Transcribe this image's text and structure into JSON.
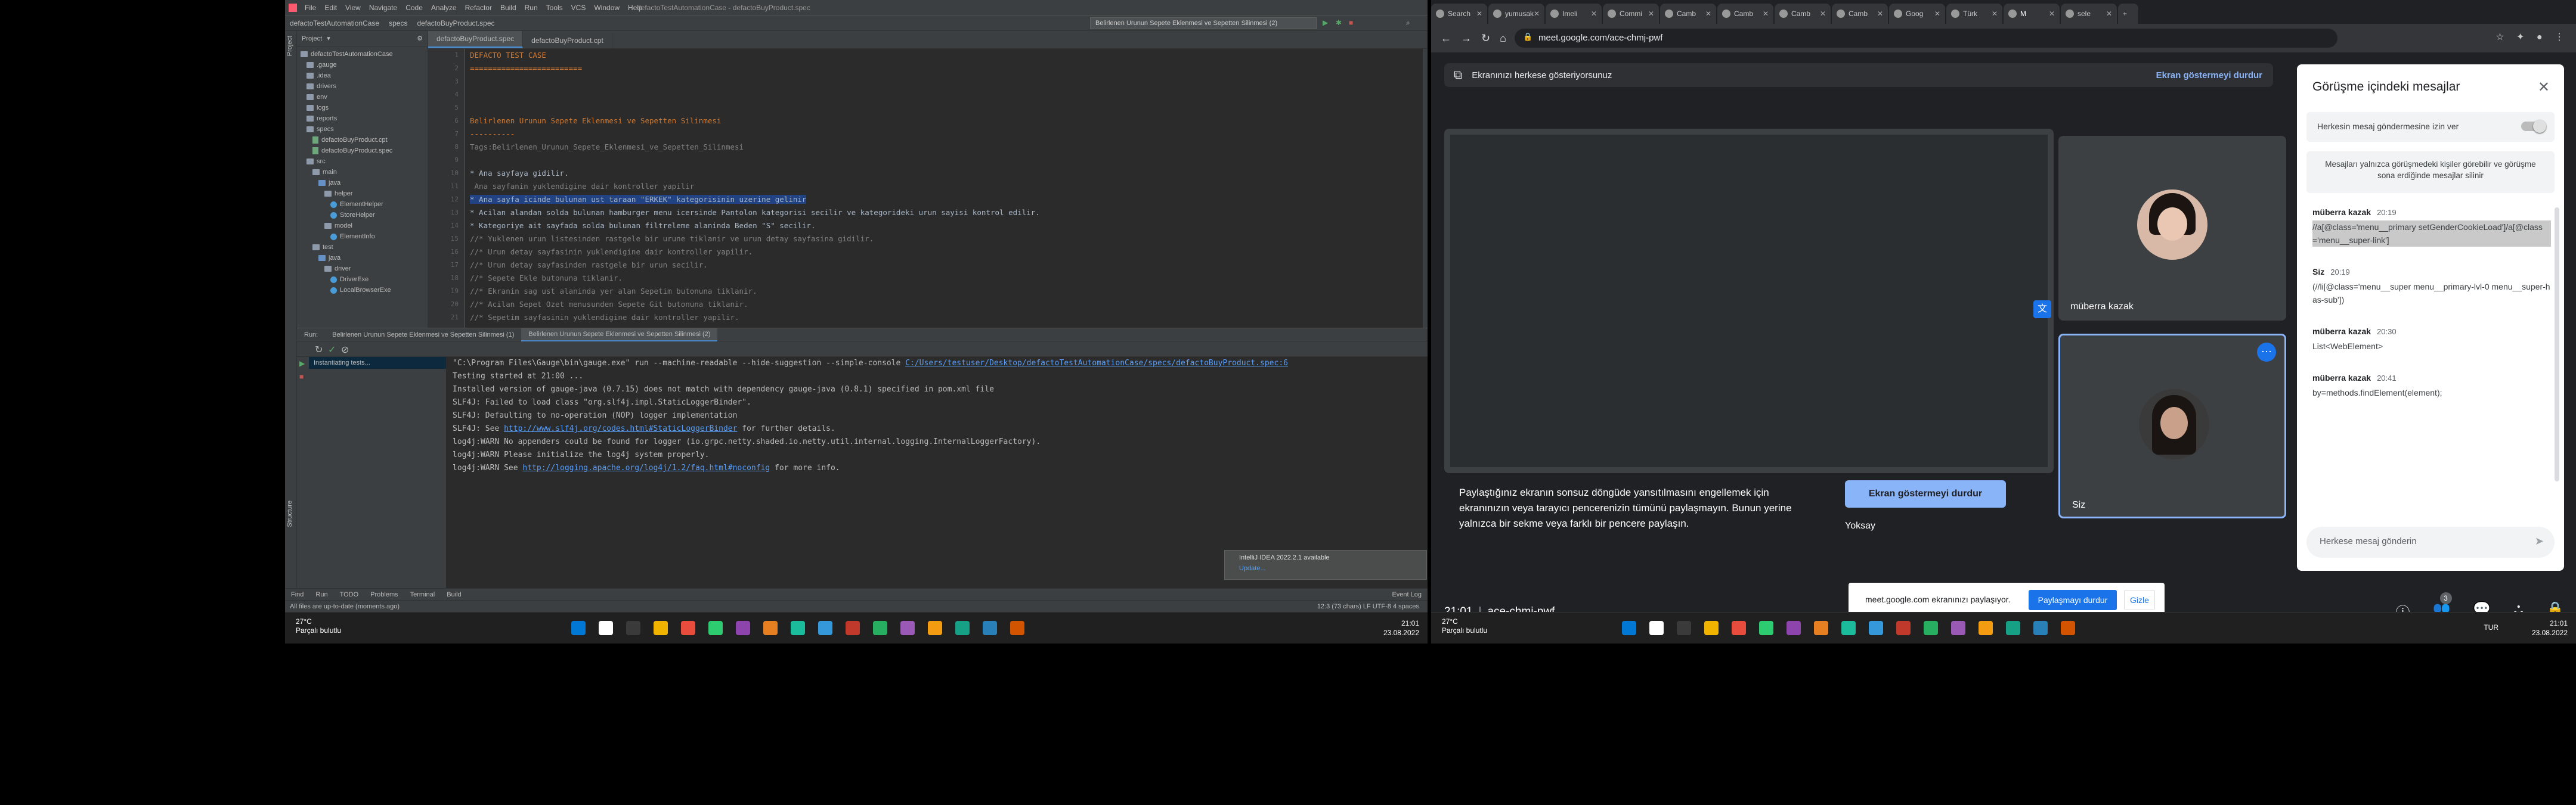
{
  "ide": {
    "menu": [
      "File",
      "Edit",
      "View",
      "Navigate",
      "Code",
      "Analyze",
      "Refactor",
      "Build",
      "Run",
      "Tools",
      "VCS",
      "Window",
      "Help"
    ],
    "window_title": "defactoTestAutomationCase - defactoBuyProduct.spec",
    "breadcrumbs": [
      "defactoTestAutomationCase",
      "specs",
      "defactoBuyProduct.spec"
    ],
    "run_config": "Belirlenen Urunun Sepete Eklenmesi ve Sepetten Silinmesi (2)",
    "project_label": "Project",
    "project_tree": [
      {
        "label": "defactoTestAutomationCase",
        "type": "folder",
        "depth": 0
      },
      {
        "label": ".gauge",
        "type": "folder",
        "depth": 1
      },
      {
        "label": ".idea",
        "type": "folder",
        "depth": 1
      },
      {
        "label": "drivers",
        "type": "folder",
        "depth": 1
      },
      {
        "label": "env",
        "type": "folder",
        "depth": 1
      },
      {
        "label": "logs",
        "type": "folder",
        "depth": 1
      },
      {
        "label": "reports",
        "type": "folder",
        "depth": 1
      },
      {
        "label": "specs",
        "type": "folder",
        "depth": 1
      },
      {
        "label": "defactoBuyProduct.cpt",
        "type": "file",
        "depth": 2
      },
      {
        "label": "defactoBuyProduct.spec",
        "type": "file",
        "depth": 2
      },
      {
        "label": "src",
        "type": "folder",
        "depth": 1
      },
      {
        "label": "main",
        "type": "folder",
        "depth": 2
      },
      {
        "label": "java",
        "type": "folder-blue",
        "depth": 3
      },
      {
        "label": "helper",
        "type": "folder",
        "depth": 4
      },
      {
        "label": "ElementHelper",
        "type": "java",
        "depth": 5
      },
      {
        "label": "StoreHelper",
        "type": "java",
        "depth": 5
      },
      {
        "label": "model",
        "type": "folder",
        "depth": 4
      },
      {
        "label": "ElementInfo",
        "type": "java",
        "depth": 5
      },
      {
        "label": "test",
        "type": "folder",
        "depth": 2
      },
      {
        "label": "java",
        "type": "folder-blue",
        "depth": 3
      },
      {
        "label": "driver",
        "type": "folder",
        "depth": 4
      },
      {
        "label": "DriverExe",
        "type": "java",
        "depth": 5
      },
      {
        "label": "LocalBrowserExe",
        "type": "java",
        "depth": 5
      }
    ],
    "editor_tabs": [
      "defactoBuyProduct.spec",
      "defactoBuyProduct.cpt"
    ],
    "code_lines": [
      {
        "n": "1",
        "t": "DEFACTO TEST CASE",
        "c": "c-orange"
      },
      {
        "n": "2",
        "t": "=========================",
        "c": "c-orange"
      },
      {
        "n": "3",
        "t": "",
        "c": "c-white"
      },
      {
        "n": "4",
        "t": "",
        "c": "c-white"
      },
      {
        "n": "5",
        "t": "",
        "c": "c-white"
      },
      {
        "n": "6",
        "t": "Belirlenen Urunun Sepete Eklenmesi ve Sepetten Silinmesi",
        "c": "c-orange"
      },
      {
        "n": "7",
        "t": "----------",
        "c": "c-orange"
      },
      {
        "n": "8",
        "t": "Tags:Belirlenen_Urunun_Sepete_Eklenmesi_ve_Sepetten_Silinmesi",
        "c": "c-gray"
      },
      {
        "n": "9",
        "t": "",
        "c": "c-white"
      },
      {
        "n": "10",
        "t": "* Ana sayfaya gidilir.",
        "c": "c-white"
      },
      {
        "n": "11",
        "t": " Ana sayfanin yuklendigine dair kontroller yapilir",
        "c": "c-gray"
      },
      {
        "n": "12",
        "t": "* Ana sayfa icinde bulunan ust taraan \"ERKEK\" kategorisinin uzerine gelinir",
        "c": "c-white",
        "hl": true
      },
      {
        "n": "13",
        "t": "* Acilan alandan solda bulunan hamburger menu icersinde Pantolon kategorisi secilir ve kategorideki urun sayisi kontrol edilir.",
        "c": "c-white"
      },
      {
        "n": "14",
        "t": "* Kategoriye ait sayfada solda bulunan filtreleme alaninda Beden \"S\" secilir.",
        "c": "c-white"
      },
      {
        "n": "15",
        "t": "//* Yuklenen urun listesinden rastgele bir urune tiklanir ve urun detay sayfasina gidilir.",
        "c": "c-gray"
      },
      {
        "n": "16",
        "t": "//* Urun detay sayfasinin yuklendigine dair kontroller yapilir.",
        "c": "c-gray"
      },
      {
        "n": "17",
        "t": "//* Urun detay sayfasinden rastgele bir urun secilir.",
        "c": "c-gray"
      },
      {
        "n": "18",
        "t": "//* Sepete Ekle butonuna tiklanir.",
        "c": "c-gray"
      },
      {
        "n": "19",
        "t": "//* Ekranin sag ust alaninda yer alan Sepetim butonuna tiklanir.",
        "c": "c-gray"
      },
      {
        "n": "20",
        "t": "//* Acilan Sepet Ozet menusunden Sepete Git butonuna tiklanir.",
        "c": "c-gray"
      },
      {
        "n": "21",
        "t": "//* Sepetim sayfasinin yuklendigine dair kontroller yapilir.",
        "c": "c-gray"
      }
    ],
    "run_label": "Run:",
    "run_tabs": [
      "Belirlenen Urunun Sepete Eklenmesi ve Sepetten Silinmesi (1)",
      "Belirlenen Urunun Sepete Eklenmesi ve Sepetten Silinmesi (2)"
    ],
    "run_tree_item": "Instantiating tests...",
    "console_lines": [
      {
        "pre": "\"C:\\Program Files\\Gauge\\bin\\gauge.exe\" run --machine-readable --hide-suggestion --simple-console ",
        "link": "C:/Users/testuser/Desktop/defactoTestAutomationCase/specs/defactoBuyProduct.spec:6",
        "post": ""
      },
      {
        "pre": "Testing started at 21:00 ...",
        "link": "",
        "post": ""
      },
      {
        "pre": "Installed version of gauge-java (0.7.15) does not match with dependency gauge-java (0.8.1) specified in pom.xml file",
        "link": "",
        "post": ""
      },
      {
        "pre": "SLF4J: Failed to load class \"org.slf4j.impl.StaticLoggerBinder\".",
        "link": "",
        "post": ""
      },
      {
        "pre": "SLF4J: Defaulting to no-operation (NOP) logger implementation",
        "link": "",
        "post": ""
      },
      {
        "pre": "SLF4J: See ",
        "link": "http://www.slf4j.org/codes.html#StaticLoggerBinder",
        "post": " for further details."
      },
      {
        "pre": "log4j:WARN No appenders could be found for logger (io.grpc.netty.shaded.io.netty.util.internal.logging.InternalLoggerFactory).",
        "link": "",
        "post": ""
      },
      {
        "pre": "log4j:WARN Please initialize the log4j system properly.",
        "link": "",
        "post": ""
      },
      {
        "pre": "log4j:WARN See ",
        "link": "http://logging.apache.org/log4j/1.2/faq.html#noconfig",
        "post": " for more info."
      }
    ],
    "notification": {
      "title": "IntelliJ IDEA 2022.2.1 available",
      "link": "Update..."
    },
    "bottom_tools": [
      "Find",
      "Run",
      "TODO",
      "Problems",
      "Terminal",
      "Build"
    ],
    "event_log": "Event Log",
    "status_left": "All files are up-to-date (moments ago)",
    "status_right": "12:3 (73 chars)   LF   UTF-8   4 spaces"
  },
  "taskbar_left": {
    "temp": "27°C",
    "desc": "Parçalı bulutlu",
    "time": "21:01",
    "date": "23.08.2022"
  },
  "browser": {
    "tabs": [
      "Search",
      "yumusak",
      "Imeli",
      "Commi",
      "Camb",
      "Camb",
      "Camb",
      "Camb",
      "Goog",
      "Türk",
      "M",
      "sele"
    ],
    "active_tab_index": 10,
    "url": "meet.google.com/ace-chmj-pwf"
  },
  "meet": {
    "presenting_banner": "Ekranınızı herkese gösteriyorsunuz",
    "stop_presenting": "Ekran göstermeyi durdur",
    "warning": "Paylaştığınız ekranın sonsuz döngüde yansıtılmasını engellemek için ekranınızın veya tarayıcı pencerenizin tümünü paylaşmayın. Bunun yerine yalnızca bir sekme veya farklı bir pencere paylaşın.",
    "stop_button": "Ekran göstermeyi durdur",
    "ignore": "Yoksay",
    "participants": [
      {
        "name": "müberra kazak"
      },
      {
        "name": "Siz"
      }
    ],
    "clock": "21:01",
    "meeting_code": "ace-chmj-pwf",
    "sharing_pill": {
      "text": "meet.google.com ekranınızı paylaşıyor.",
      "stop": "Paylaşmayı durdur",
      "hide": "Gizle"
    },
    "people_count": "3",
    "chat": {
      "title": "Görüşme içindeki mesajlar",
      "allow_label": "Herkesin mesaj göndermesine izin ver",
      "info": "Mesajları yalnızca görüşmedeki kişiler görebilir ve görüşme sona erdiğinde mesajlar silinir",
      "messages": [
        {
          "sender": "müberra kazak",
          "time": "20:19",
          "text": "//a[@class='menu__primary setGenderCookieLoad']/a[@class='menu__super-link']",
          "selected": true
        },
        {
          "sender": "Siz",
          "time": "20:19",
          "text": "(//li[@class='menu__super menu__primary-lvl-0 menu__super-has-sub'])",
          "selected": false
        },
        {
          "sender": "müberra kazak",
          "time": "20:30",
          "text": "List<WebElement>",
          "selected": false
        },
        {
          "sender": "müberra kazak",
          "time": "20:41",
          "text": "by=methods.findElement(element);",
          "selected": false
        }
      ],
      "input_placeholder": "Herkese mesaj gönderin"
    }
  },
  "taskbar_right": {
    "temp": "27°C",
    "desc": "Parçalı bulutlu",
    "lang": "TUR",
    "time": "21:01",
    "date": "23.08.2022"
  }
}
